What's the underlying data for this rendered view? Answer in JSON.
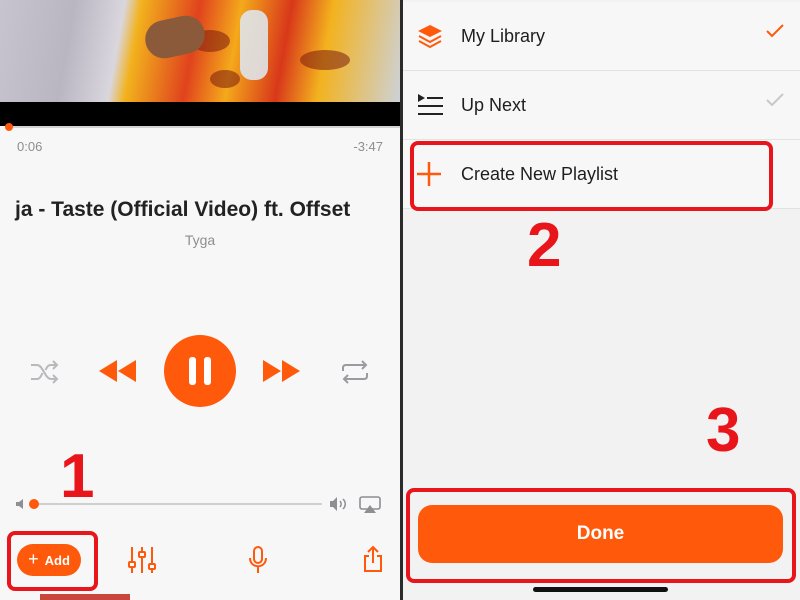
{
  "player": {
    "elapsed": "0:06",
    "remaining": "-3:47",
    "song_title": "ja - Taste (Official Video) ft. Offset",
    "artist": "Tyga",
    "playback_progress": 0.03,
    "volume_level": 0.02,
    "add_label": "Add"
  },
  "menu": {
    "items": [
      {
        "label": "My Library",
        "icon": "stack-icon",
        "check": "checked"
      },
      {
        "label": "Up Next",
        "icon": "queue-icon",
        "check": "unchecked"
      },
      {
        "label": "Create New Playlist",
        "icon": "plus-icon"
      }
    ],
    "done_label": "Done"
  },
  "annotations": {
    "step1": "1",
    "step2": "2",
    "step3": "3"
  },
  "colors": {
    "accent": "#ff5a0c",
    "annotation": "#e8161b"
  }
}
